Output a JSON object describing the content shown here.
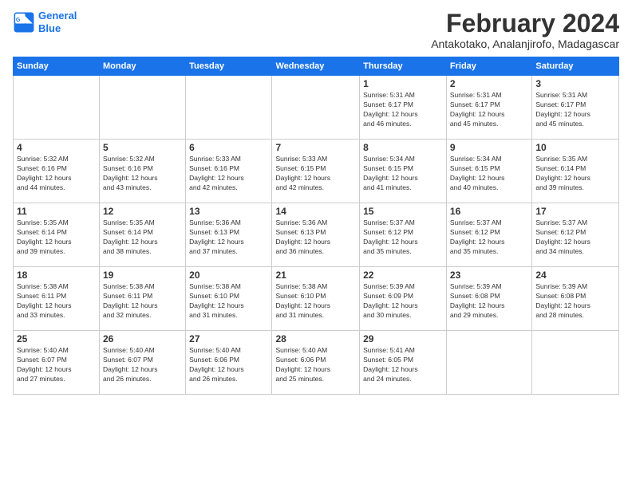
{
  "logo": {
    "line1": "General",
    "line2": "Blue"
  },
  "title": "February 2024",
  "location": "Antakotako, Analanjirofo, Madagascar",
  "days_of_week": [
    "Sunday",
    "Monday",
    "Tuesday",
    "Wednesday",
    "Thursday",
    "Friday",
    "Saturday"
  ],
  "weeks": [
    [
      {
        "day": "",
        "info": ""
      },
      {
        "day": "",
        "info": ""
      },
      {
        "day": "",
        "info": ""
      },
      {
        "day": "",
        "info": ""
      },
      {
        "day": "1",
        "info": "Sunrise: 5:31 AM\nSunset: 6:17 PM\nDaylight: 12 hours\nand 46 minutes."
      },
      {
        "day": "2",
        "info": "Sunrise: 5:31 AM\nSunset: 6:17 PM\nDaylight: 12 hours\nand 45 minutes."
      },
      {
        "day": "3",
        "info": "Sunrise: 5:31 AM\nSunset: 6:17 PM\nDaylight: 12 hours\nand 45 minutes."
      }
    ],
    [
      {
        "day": "4",
        "info": "Sunrise: 5:32 AM\nSunset: 6:16 PM\nDaylight: 12 hours\nand 44 minutes."
      },
      {
        "day": "5",
        "info": "Sunrise: 5:32 AM\nSunset: 6:16 PM\nDaylight: 12 hours\nand 43 minutes."
      },
      {
        "day": "6",
        "info": "Sunrise: 5:33 AM\nSunset: 6:16 PM\nDaylight: 12 hours\nand 42 minutes."
      },
      {
        "day": "7",
        "info": "Sunrise: 5:33 AM\nSunset: 6:15 PM\nDaylight: 12 hours\nand 42 minutes."
      },
      {
        "day": "8",
        "info": "Sunrise: 5:34 AM\nSunset: 6:15 PM\nDaylight: 12 hours\nand 41 minutes."
      },
      {
        "day": "9",
        "info": "Sunrise: 5:34 AM\nSunset: 6:15 PM\nDaylight: 12 hours\nand 40 minutes."
      },
      {
        "day": "10",
        "info": "Sunrise: 5:35 AM\nSunset: 6:14 PM\nDaylight: 12 hours\nand 39 minutes."
      }
    ],
    [
      {
        "day": "11",
        "info": "Sunrise: 5:35 AM\nSunset: 6:14 PM\nDaylight: 12 hours\nand 39 minutes."
      },
      {
        "day": "12",
        "info": "Sunrise: 5:35 AM\nSunset: 6:14 PM\nDaylight: 12 hours\nand 38 minutes."
      },
      {
        "day": "13",
        "info": "Sunrise: 5:36 AM\nSunset: 6:13 PM\nDaylight: 12 hours\nand 37 minutes."
      },
      {
        "day": "14",
        "info": "Sunrise: 5:36 AM\nSunset: 6:13 PM\nDaylight: 12 hours\nand 36 minutes."
      },
      {
        "day": "15",
        "info": "Sunrise: 5:37 AM\nSunset: 6:12 PM\nDaylight: 12 hours\nand 35 minutes."
      },
      {
        "day": "16",
        "info": "Sunrise: 5:37 AM\nSunset: 6:12 PM\nDaylight: 12 hours\nand 35 minutes."
      },
      {
        "day": "17",
        "info": "Sunrise: 5:37 AM\nSunset: 6:12 PM\nDaylight: 12 hours\nand 34 minutes."
      }
    ],
    [
      {
        "day": "18",
        "info": "Sunrise: 5:38 AM\nSunset: 6:11 PM\nDaylight: 12 hours\nand 33 minutes."
      },
      {
        "day": "19",
        "info": "Sunrise: 5:38 AM\nSunset: 6:11 PM\nDaylight: 12 hours\nand 32 minutes."
      },
      {
        "day": "20",
        "info": "Sunrise: 5:38 AM\nSunset: 6:10 PM\nDaylight: 12 hours\nand 31 minutes."
      },
      {
        "day": "21",
        "info": "Sunrise: 5:38 AM\nSunset: 6:10 PM\nDaylight: 12 hours\nand 31 minutes."
      },
      {
        "day": "22",
        "info": "Sunrise: 5:39 AM\nSunset: 6:09 PM\nDaylight: 12 hours\nand 30 minutes."
      },
      {
        "day": "23",
        "info": "Sunrise: 5:39 AM\nSunset: 6:08 PM\nDaylight: 12 hours\nand 29 minutes."
      },
      {
        "day": "24",
        "info": "Sunrise: 5:39 AM\nSunset: 6:08 PM\nDaylight: 12 hours\nand 28 minutes."
      }
    ],
    [
      {
        "day": "25",
        "info": "Sunrise: 5:40 AM\nSunset: 6:07 PM\nDaylight: 12 hours\nand 27 minutes."
      },
      {
        "day": "26",
        "info": "Sunrise: 5:40 AM\nSunset: 6:07 PM\nDaylight: 12 hours\nand 26 minutes."
      },
      {
        "day": "27",
        "info": "Sunrise: 5:40 AM\nSunset: 6:06 PM\nDaylight: 12 hours\nand 26 minutes."
      },
      {
        "day": "28",
        "info": "Sunrise: 5:40 AM\nSunset: 6:06 PM\nDaylight: 12 hours\nand 25 minutes."
      },
      {
        "day": "29",
        "info": "Sunrise: 5:41 AM\nSunset: 6:05 PM\nDaylight: 12 hours\nand 24 minutes."
      },
      {
        "day": "",
        "info": ""
      },
      {
        "day": "",
        "info": ""
      }
    ]
  ]
}
